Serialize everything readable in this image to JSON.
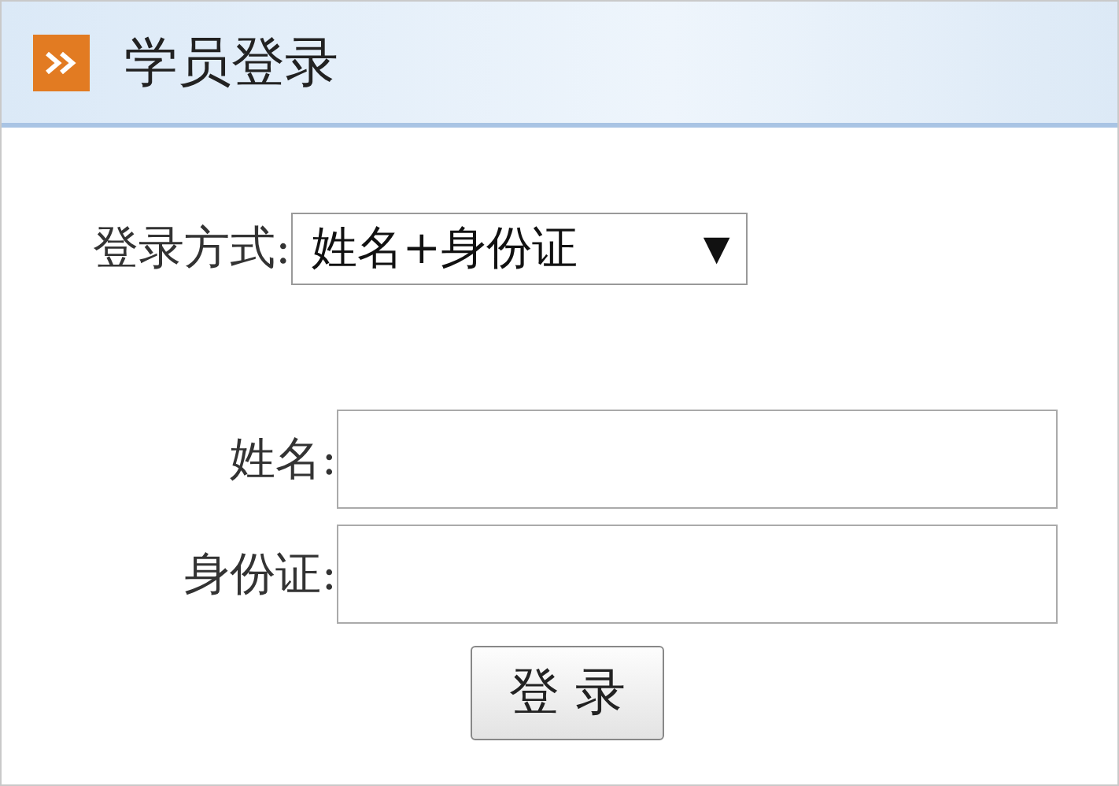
{
  "header": {
    "title": "学员登录"
  },
  "login_method": {
    "label": "登录方式:",
    "value": "姓名+身份证",
    "arrow": "▼"
  },
  "fields": [
    {
      "label": "姓名:"
    },
    {
      "label": "身份证:"
    }
  ],
  "button": "登 录"
}
